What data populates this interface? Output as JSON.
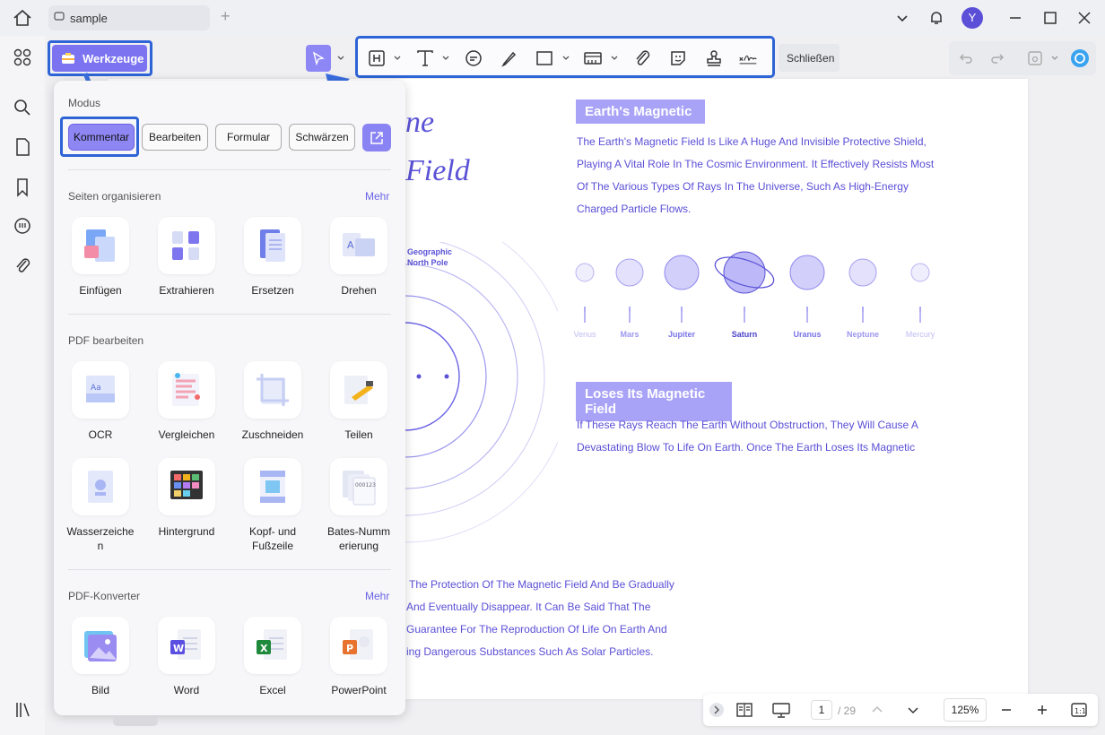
{
  "titlebar": {
    "tab_label": "sample",
    "avatar_initial": "Y"
  },
  "toolbar": {
    "tools_label": "Werkzeuge",
    "close_label": "Schließen"
  },
  "panel": {
    "mode_title": "Modus",
    "modes": [
      "Kommentar",
      "Bearbeiten",
      "Formular",
      "Schwärzen"
    ],
    "organize_title": "Seiten organisieren",
    "organize_more": "Mehr",
    "organize_items": [
      "Einfügen",
      "Extrahieren",
      "Ersetzen",
      "Drehen"
    ],
    "edit_title": "PDF bearbeiten",
    "edit_items": [
      "OCR",
      "Vergleichen",
      "Zuschneiden",
      "Teilen",
      "Wasserzeichen",
      "Hintergrund",
      "Kopf- und Fußzeile",
      "Bates-Nummerierung"
    ],
    "convert_title": "PDF-Konverter",
    "convert_more": "Mehr",
    "convert_items": [
      "Bild",
      "Word",
      "Excel",
      "PowerPoint"
    ]
  },
  "document": {
    "title_fragment_1": "ne",
    "title_fragment_2": "Field",
    "heading_1": "Earth's Magnetic",
    "para_1": [
      "The Earth's Magnetic Field Is Like A Huge And Invisible Protective Shield,",
      "Playing A Vital Role In The Cosmic Environment. It Effectively Resists Most",
      "Of The Various Types Of Rays In The Universe, Such As High-Energy",
      "Charged Particle Flows."
    ],
    "north_pole_label_1": "Geographic",
    "north_pole_label_2": "North Pole",
    "planets": [
      "Venus",
      "Mars",
      "Jupiter",
      "Saturn",
      "Uranus",
      "Neptune",
      "Mercury"
    ],
    "heading_2": "Loses Its Magnetic Field",
    "para_2": [
      "If These Rays Reach The Earth Without Obstruction, They Will Cause A",
      "Devastating Blow To Life On Earth. Once The Earth Loses Its Magnetic"
    ],
    "para_3": [
      "The Protection Of The Magnetic Field And Be Gradually",
      "And Eventually Disappear. It Can Be Said That The",
      "Guarantee For The Reproduction Of Life On Earth And",
      "ing Dangerous Substances Such As Solar Particles."
    ]
  },
  "bottombar": {
    "current_page": "1",
    "total_pages": "/ 29",
    "zoom": "125%"
  },
  "colors": {
    "accent": "#7b73f0",
    "highlight_border": "#2e64d6",
    "doc_text": "#5a4fd6"
  }
}
